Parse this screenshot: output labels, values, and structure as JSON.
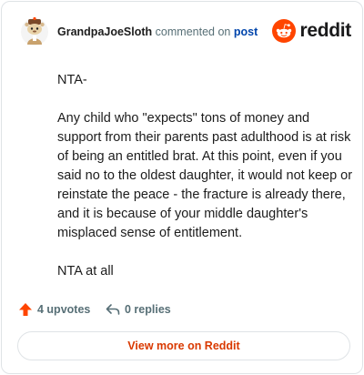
{
  "header": {
    "username": "GrandpaJoeSloth",
    "action_text": "commented on",
    "post_link": "post",
    "brand_word": "reddit",
    "avatar_icon": "snoo-avatar-icon",
    "brand_icon": "reddit-logo-icon"
  },
  "comment": {
    "paragraphs": [
      "NTA-",
      "Any child who \"expects\" tons of money and support from their parents past adulthood is at risk of being an entitled brat. At this point, even if you said no to the oldest daughter, it would not keep or reinstate the peace - the fracture is already there, and it is because of your middle daughter's misplaced sense of entitlement.",
      "NTA at all"
    ]
  },
  "footer": {
    "upvotes": "4 upvotes",
    "replies": "0 replies",
    "upvote_icon": "upvote-arrow-icon",
    "reply_icon": "reply-arrow-icon"
  },
  "cta": {
    "label": "View more on Reddit"
  },
  "colors": {
    "accent": "#ff4500",
    "link": "#0045ac",
    "muted": "#576f76",
    "cta_text": "#d93900",
    "border": "#dfe3e6"
  }
}
